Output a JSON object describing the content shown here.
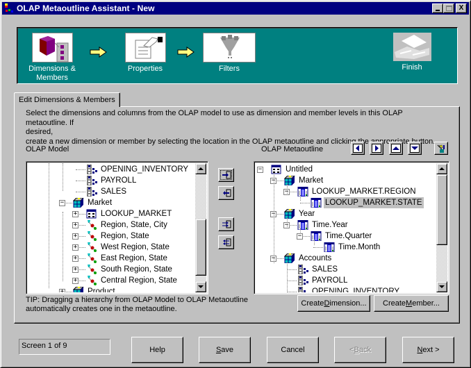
{
  "window": {
    "title": "OLAP Metaoutline Assistant - New",
    "controls": {
      "minimize": "_",
      "maximize": "□",
      "close": "X"
    }
  },
  "steps": [
    {
      "label_line1": "Dimensions &",
      "label_line2": "Members",
      "icon": "cube-members-icon",
      "state": "active"
    },
    {
      "label_line1": "Properties",
      "label_line2": "",
      "icon": "properties-document-icon",
      "state": "enabled"
    },
    {
      "label_line1": "Filters",
      "label_line2": "",
      "icon": "filter-funnel-icon",
      "state": "enabled"
    },
    {
      "label_line1": "Finish",
      "label_line2": "",
      "icon": "finish-icon",
      "state": "disabled"
    }
  ],
  "tab": {
    "label": "Edit Dimensions & Members"
  },
  "description": {
    "line1": "Select the dimensions and columns from the OLAP model to use as dimension and member levels in this OLAP metaoutline. If",
    "line2": "desired,",
    "line3": "create a new dimension or member by selecting the location in the OLAP metaoutline and clicking the appropriate button."
  },
  "olap_model": {
    "label": "OLAP Model",
    "items": [
      {
        "text": "OPENING_INVENTORY",
        "type": "measure",
        "level": 2,
        "expander": ""
      },
      {
        "text": "PAYROLL",
        "type": "measure",
        "level": 2,
        "expander": ""
      },
      {
        "text": "SALES",
        "type": "measure",
        "level": 2,
        "expander": ""
      },
      {
        "text": "Market",
        "type": "dimension",
        "level": 1,
        "expander": "−"
      },
      {
        "text": "LOOKUP_MARKET",
        "type": "table",
        "level": 2,
        "expander": "+"
      },
      {
        "text": "Region, State, City",
        "type": "hierarchy",
        "level": 2,
        "expander": "+"
      },
      {
        "text": "Region, State",
        "type": "hierarchy",
        "level": 2,
        "expander": "+"
      },
      {
        "text": "West Region, State",
        "type": "hierarchy",
        "level": 2,
        "expander": "+"
      },
      {
        "text": "East Region, State",
        "type": "hierarchy",
        "level": 2,
        "expander": "+"
      },
      {
        "text": "South Region, State",
        "type": "hierarchy",
        "level": 2,
        "expander": "+"
      },
      {
        "text": "Central Region, State",
        "type": "hierarchy",
        "level": 2,
        "expander": "+"
      },
      {
        "text": "Product",
        "type": "dimension",
        "level": 1,
        "expander": "+"
      }
    ]
  },
  "olap_metaoutline": {
    "label": "OLAP Metaoutline",
    "items": [
      {
        "text": "Untitled",
        "type": "table",
        "level": 0,
        "expander": "−",
        "selected": false
      },
      {
        "text": "Market",
        "type": "dimension",
        "level": 1,
        "expander": "−",
        "selected": false
      },
      {
        "text": "LOOKUP_MARKET.REGION",
        "type": "member",
        "level": 2,
        "expander": "−",
        "selected": false
      },
      {
        "text": "LOOKUP_MARKET.STATE",
        "type": "member",
        "level": 3,
        "expander": "",
        "selected": true
      },
      {
        "text": "Year",
        "type": "dimension",
        "level": 1,
        "expander": "−",
        "selected": false
      },
      {
        "text": "Time.Year",
        "type": "member",
        "level": 2,
        "expander": "−",
        "selected": false
      },
      {
        "text": "Time.Quarter",
        "type": "member",
        "level": 3,
        "expander": "−",
        "selected": false
      },
      {
        "text": "Time.Month",
        "type": "member",
        "level": 4,
        "expander": "",
        "selected": false
      },
      {
        "text": "Accounts",
        "type": "dimension",
        "level": 1,
        "expander": "−",
        "selected": false
      },
      {
        "text": "SALES",
        "type": "measure",
        "level": 2,
        "expander": "",
        "selected": false
      },
      {
        "text": "PAYROLL",
        "type": "measure",
        "level": 2,
        "expander": "",
        "selected": false
      },
      {
        "text": "OPENING_INVENTORY",
        "type": "measure",
        "level": 2,
        "expander": "",
        "selected": false
      }
    ]
  },
  "move_buttons": [
    {
      "name": "add-to-metaoutline-button",
      "icon": "move-right-icon"
    },
    {
      "name": "remove-from-metaoutline-button",
      "icon": "move-left-icon"
    },
    {
      "name": "add-all-button",
      "icon": "move-all-right-icon"
    },
    {
      "name": "remove-all-button",
      "icon": "move-all-left-icon"
    }
  ],
  "nav_buttons": [
    {
      "name": "move-left-button",
      "icon": "arrow-left-icon"
    },
    {
      "name": "move-right-button",
      "icon": "arrow-right-icon"
    },
    {
      "name": "move-up-button",
      "icon": "arrow-up-icon"
    },
    {
      "name": "move-down-button",
      "icon": "arrow-down-icon"
    },
    {
      "name": "properties-button",
      "icon": "member-properties-icon"
    }
  ],
  "tip": {
    "line1": "TIP: Dragging a hierarchy from OLAP Model to OLAP Metaoutline",
    "line2": "automatically creates one in the metaoutline."
  },
  "create_dimension": {
    "pre": "Create ",
    "u": "D",
    "post": "imension..."
  },
  "create_member": {
    "pre": "Create ",
    "u": "M",
    "post": "ember..."
  },
  "status": "Screen 1 of 9",
  "footer": {
    "help": {
      "pre": "Help",
      "u": "",
      "post": ""
    },
    "save": {
      "pre": "",
      "u": "S",
      "post": "ave"
    },
    "cancel": {
      "pre": "Cancel",
      "u": "",
      "post": ""
    },
    "back": {
      "pre": "< ",
      "u": "B",
      "post": "ack",
      "disabled": true
    },
    "next": {
      "pre": "",
      "u": "N",
      "post": "ext >"
    }
  },
  "colors": {
    "title_bar": "#000080",
    "steps_background": "#008080",
    "face": "#c0c0c0",
    "selection": "#c0c0c0"
  }
}
